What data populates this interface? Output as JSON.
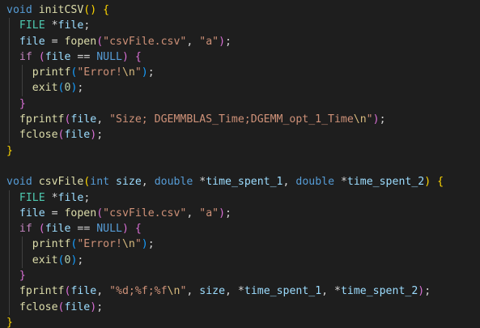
{
  "editor": {
    "theme": {
      "background": "#1e1e1e",
      "keyword": "#569cd6",
      "control": "#c586c0",
      "type": "#4ec9b0",
      "function": "#dcdcaa",
      "variable": "#9cdcfe",
      "string": "#ce9178",
      "number": "#b5cea8",
      "bracket_level_1": "#ffd700",
      "bracket_level_2": "#da70d6",
      "bracket_level_3": "#179fff"
    },
    "lines": [
      {
        "indent": 0,
        "tokens": [
          {
            "t": "void",
            "c": "kw"
          },
          {
            "t": " ",
            "c": "pun"
          },
          {
            "t": "initCSV",
            "c": "fn"
          },
          {
            "t": "()",
            "c": "b1"
          },
          {
            "t": " ",
            "c": "pun"
          },
          {
            "t": "{",
            "c": "b1"
          }
        ]
      },
      {
        "indent": 1,
        "tokens": [
          {
            "t": "FILE",
            "c": "ty"
          },
          {
            "t": " *",
            "c": "pun"
          },
          {
            "t": "file",
            "c": "var"
          },
          {
            "t": ";",
            "c": "pun"
          }
        ]
      },
      {
        "indent": 1,
        "tokens": [
          {
            "t": "file",
            "c": "var"
          },
          {
            "t": " = ",
            "c": "pun"
          },
          {
            "t": "fopen",
            "c": "fn"
          },
          {
            "t": "(",
            "c": "b2"
          },
          {
            "t": "\"csvFile.csv\"",
            "c": "str"
          },
          {
            "t": ", ",
            "c": "pun"
          },
          {
            "t": "\"a\"",
            "c": "str"
          },
          {
            "t": ")",
            "c": "b2"
          },
          {
            "t": ";",
            "c": "pun"
          }
        ]
      },
      {
        "indent": 1,
        "tokens": [
          {
            "t": "if",
            "c": "ctl"
          },
          {
            "t": " ",
            "c": "pun"
          },
          {
            "t": "(",
            "c": "b2"
          },
          {
            "t": "file",
            "c": "var"
          },
          {
            "t": " == ",
            "c": "pun"
          },
          {
            "t": "NULL",
            "c": "kw"
          },
          {
            "t": ")",
            "c": "b2"
          },
          {
            "t": " ",
            "c": "pun"
          },
          {
            "t": "{",
            "c": "b2"
          }
        ]
      },
      {
        "indent": 2,
        "tokens": [
          {
            "t": "printf",
            "c": "fn"
          },
          {
            "t": "(",
            "c": "b3"
          },
          {
            "t": "\"Error!",
            "c": "str"
          },
          {
            "t": "\\n",
            "c": "esc"
          },
          {
            "t": "\"",
            "c": "str"
          },
          {
            "t": ")",
            "c": "b3"
          },
          {
            "t": ";",
            "c": "pun"
          }
        ]
      },
      {
        "indent": 2,
        "tokens": [
          {
            "t": "exit",
            "c": "fn"
          },
          {
            "t": "(",
            "c": "b3"
          },
          {
            "t": "0",
            "c": "num"
          },
          {
            "t": ")",
            "c": "b3"
          },
          {
            "t": ";",
            "c": "pun"
          }
        ]
      },
      {
        "indent": 1,
        "tokens": [
          {
            "t": "}",
            "c": "b2"
          }
        ]
      },
      {
        "indent": 1,
        "tokens": [
          {
            "t": "fprintf",
            "c": "fn"
          },
          {
            "t": "(",
            "c": "b2"
          },
          {
            "t": "file",
            "c": "var"
          },
          {
            "t": ", ",
            "c": "pun"
          },
          {
            "t": "\"Size; DGEMMBLAS_Time;DGEMM_opt_1_Time",
            "c": "str"
          },
          {
            "t": "\\n",
            "c": "esc"
          },
          {
            "t": "\"",
            "c": "str"
          },
          {
            "t": ")",
            "c": "b2"
          },
          {
            "t": ";",
            "c": "pun"
          }
        ]
      },
      {
        "indent": 1,
        "tokens": [
          {
            "t": "fclose",
            "c": "fn"
          },
          {
            "t": "(",
            "c": "b2"
          },
          {
            "t": "file",
            "c": "var"
          },
          {
            "t": ")",
            "c": "b2"
          },
          {
            "t": ";",
            "c": "pun"
          }
        ]
      },
      {
        "indent": 0,
        "tokens": [
          {
            "t": "}",
            "c": "b1"
          }
        ]
      },
      {
        "indent": 0,
        "tokens": []
      },
      {
        "indent": 0,
        "tokens": [
          {
            "t": "void",
            "c": "kw"
          },
          {
            "t": " ",
            "c": "pun"
          },
          {
            "t": "csvFile",
            "c": "fn"
          },
          {
            "t": "(",
            "c": "b1"
          },
          {
            "t": "int",
            "c": "kw"
          },
          {
            "t": " ",
            "c": "pun"
          },
          {
            "t": "size",
            "c": "var"
          },
          {
            "t": ", ",
            "c": "pun"
          },
          {
            "t": "double",
            "c": "kw"
          },
          {
            "t": " *",
            "c": "pun"
          },
          {
            "t": "time_spent_1",
            "c": "var"
          },
          {
            "t": ", ",
            "c": "pun"
          },
          {
            "t": "double",
            "c": "kw"
          },
          {
            "t": " *",
            "c": "pun"
          },
          {
            "t": "time_spent_2",
            "c": "var"
          },
          {
            "t": ")",
            "c": "b1"
          },
          {
            "t": " ",
            "c": "pun"
          },
          {
            "t": "{",
            "c": "b1"
          }
        ]
      },
      {
        "indent": 1,
        "tokens": [
          {
            "t": "FILE",
            "c": "ty"
          },
          {
            "t": " *",
            "c": "pun"
          },
          {
            "t": "file",
            "c": "var"
          },
          {
            "t": ";",
            "c": "pun"
          }
        ]
      },
      {
        "indent": 1,
        "tokens": [
          {
            "t": "file",
            "c": "var"
          },
          {
            "t": " = ",
            "c": "pun"
          },
          {
            "t": "fopen",
            "c": "fn"
          },
          {
            "t": "(",
            "c": "b2"
          },
          {
            "t": "\"csvFile.csv\"",
            "c": "str"
          },
          {
            "t": ", ",
            "c": "pun"
          },
          {
            "t": "\"a\"",
            "c": "str"
          },
          {
            "t": ")",
            "c": "b2"
          },
          {
            "t": ";",
            "c": "pun"
          }
        ]
      },
      {
        "indent": 1,
        "tokens": [
          {
            "t": "if",
            "c": "ctl"
          },
          {
            "t": " ",
            "c": "pun"
          },
          {
            "t": "(",
            "c": "b2"
          },
          {
            "t": "file",
            "c": "var"
          },
          {
            "t": " == ",
            "c": "pun"
          },
          {
            "t": "NULL",
            "c": "kw"
          },
          {
            "t": ")",
            "c": "b2"
          },
          {
            "t": " ",
            "c": "pun"
          },
          {
            "t": "{",
            "c": "b2"
          }
        ]
      },
      {
        "indent": 2,
        "tokens": [
          {
            "t": "printf",
            "c": "fn"
          },
          {
            "t": "(",
            "c": "b3"
          },
          {
            "t": "\"Error!",
            "c": "str"
          },
          {
            "t": "\\n",
            "c": "esc"
          },
          {
            "t": "\"",
            "c": "str"
          },
          {
            "t": ")",
            "c": "b3"
          },
          {
            "t": ";",
            "c": "pun"
          }
        ]
      },
      {
        "indent": 2,
        "tokens": [
          {
            "t": "exit",
            "c": "fn"
          },
          {
            "t": "(",
            "c": "b3"
          },
          {
            "t": "0",
            "c": "num"
          },
          {
            "t": ")",
            "c": "b3"
          },
          {
            "t": ";",
            "c": "pun"
          }
        ]
      },
      {
        "indent": 1,
        "tokens": [
          {
            "t": "}",
            "c": "b2"
          }
        ]
      },
      {
        "indent": 1,
        "tokens": [
          {
            "t": "fprintf",
            "c": "fn"
          },
          {
            "t": "(",
            "c": "b2"
          },
          {
            "t": "file",
            "c": "var"
          },
          {
            "t": ", ",
            "c": "pun"
          },
          {
            "t": "\"%d;%f;%f",
            "c": "str"
          },
          {
            "t": "\\n",
            "c": "esc"
          },
          {
            "t": "\"",
            "c": "str"
          },
          {
            "t": ", ",
            "c": "pun"
          },
          {
            "t": "size",
            "c": "var"
          },
          {
            "t": ", *",
            "c": "pun"
          },
          {
            "t": "time_spent_1",
            "c": "var"
          },
          {
            "t": ", *",
            "c": "pun"
          },
          {
            "t": "time_spent_2",
            "c": "var"
          },
          {
            "t": ")",
            "c": "b2"
          },
          {
            "t": ";",
            "c": "pun"
          }
        ]
      },
      {
        "indent": 1,
        "tokens": [
          {
            "t": "fclose",
            "c": "fn"
          },
          {
            "t": "(",
            "c": "b2"
          },
          {
            "t": "file",
            "c": "var"
          },
          {
            "t": ")",
            "c": "b2"
          },
          {
            "t": ";",
            "c": "pun"
          }
        ]
      },
      {
        "indent": 0,
        "tokens": [
          {
            "t": "}",
            "c": "b1"
          }
        ]
      }
    ]
  }
}
